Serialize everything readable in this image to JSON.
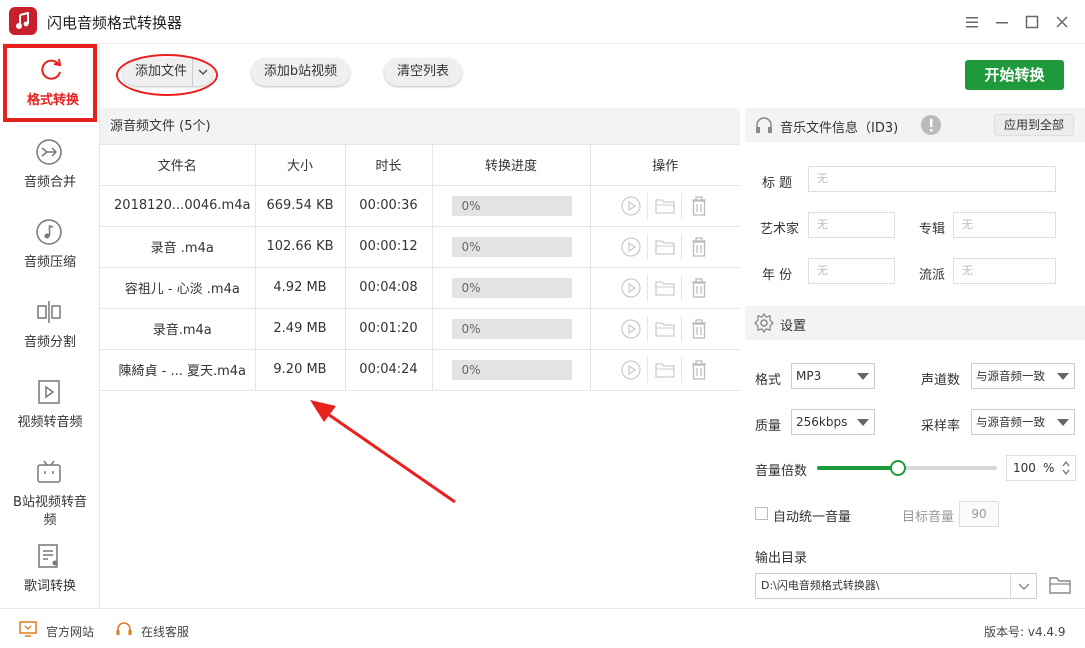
{
  "app": {
    "title": "闪电音频格式转换器",
    "version_label": "版本号: v4.4.9"
  },
  "sidebar": {
    "items": [
      {
        "label": "格式转换",
        "icon": "refresh-icon",
        "active": true
      },
      {
        "label": "音频合并",
        "icon": "merge-icon"
      },
      {
        "label": "音频压缩",
        "icon": "compress-icon"
      },
      {
        "label": "音频分割",
        "icon": "split-icon"
      },
      {
        "label": "视频转音频",
        "icon": "video-to-audio-icon"
      },
      {
        "label": "B站视频转音频",
        "icon": "bilibili-icon"
      },
      {
        "label": "歌词转换",
        "icon": "lyrics-icon"
      }
    ]
  },
  "toolbar": {
    "add_file": "添加文件",
    "add_bilibili": "添加b站视频",
    "clear_list": "清空列表",
    "start": "开始转换"
  },
  "file_list": {
    "header": "源音频文件 (5个)",
    "columns": [
      "文件名",
      "大小",
      "时长",
      "转换进度",
      "操作"
    ],
    "rows": [
      {
        "name": "2018120...0046.m4a",
        "size": "669.54 KB",
        "duration": "00:00:36",
        "progress": "0%",
        "progress_value": 0
      },
      {
        "name": "录音 .m4a",
        "size": "102.66 KB",
        "duration": "00:00:12",
        "progress": "0%",
        "progress_value": 0
      },
      {
        "name": "容祖儿 - 心淡 .m4a",
        "size": "4.92 MB",
        "duration": "00:04:08",
        "progress": "0%",
        "progress_value": 0
      },
      {
        "name": "录音.m4a",
        "size": "2.49 MB",
        "duration": "00:01:20",
        "progress": "0%",
        "progress_value": 0
      },
      {
        "name": "陳綺貞 - ... 夏天.m4a",
        "size": "9.20 MB",
        "duration": "00:04:24",
        "progress": "0%",
        "progress_value": 0
      }
    ]
  },
  "id3": {
    "header": "音乐文件信息（ID3)",
    "apply_all": "应用到全部",
    "title_label": "标  题",
    "title_value": "无",
    "artist_label": "艺术家",
    "artist_value": "无",
    "album_label": "专辑",
    "album_value": "无",
    "year_label": "年  份",
    "year_value": "无",
    "genre_label": "流派",
    "genre_value": "无"
  },
  "settings": {
    "header": "设置",
    "format_label": "格式",
    "format_value": "MP3",
    "channels_label": "声道数",
    "channels_value": "与源音频一致",
    "quality_label": "质量",
    "quality_value": "256kbps",
    "samplerate_label": "采样率",
    "samplerate_value": "与源音频一致",
    "volume_label": "音量倍数",
    "volume_value": "100",
    "volume_unit": "%",
    "volume_fraction": 0.45,
    "auto_volume_label": "自动统一音量",
    "auto_volume_checked": false,
    "target_volume_label": "目标音量",
    "target_volume_value": "90",
    "output_label": "输出目录",
    "output_path": "D:\\闪电音频格式转换器\\"
  },
  "footer": {
    "website": "官方网站",
    "support": "在线客服"
  },
  "colors": {
    "accent_red": "#e8201e",
    "start_green": "#1e9a3c",
    "slider_green": "#1e9a3c"
  }
}
